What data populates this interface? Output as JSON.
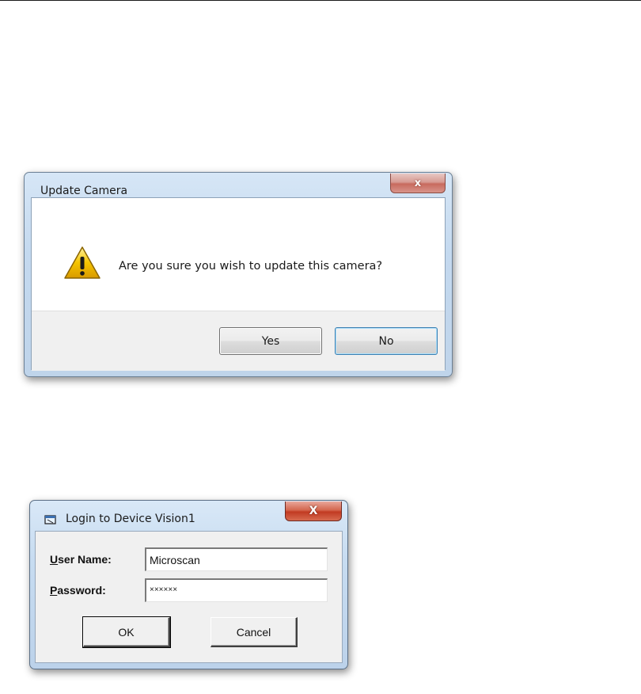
{
  "update_dialog": {
    "title": "Update Camera",
    "close_glyph": "x",
    "icon": "warning-icon",
    "message": "Are you sure you wish to update this camera?",
    "yes_label": "Yes",
    "no_label": "No"
  },
  "login_dialog": {
    "title": "Login to Device Vision1",
    "app_icon": "window-app-icon",
    "close_glyph": "X",
    "user_label_mnemonic": "U",
    "user_label_rest": "ser Name:",
    "user_value": "Microscan",
    "password_label_mnemonic": "P",
    "password_label_rest": "assword:",
    "password_value": "××××××",
    "ok_label": "OK",
    "cancel_label": "Cancel"
  },
  "colors": {
    "aero_frame": "#c4d9ef",
    "close_red": "#c23a22",
    "warning_yellow": "#f5c400"
  }
}
